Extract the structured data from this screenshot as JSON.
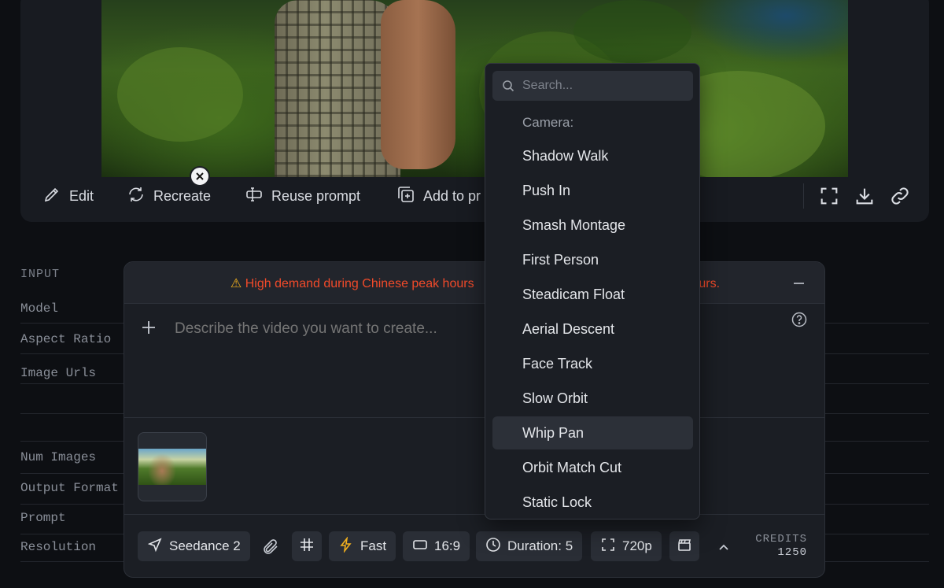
{
  "actions": {
    "edit": "Edit",
    "recreate": "Recreate",
    "reuse_prompt": "Reuse prompt",
    "add_to": "Add to pr"
  },
  "params": {
    "section_label": "INPUT",
    "rows": [
      "Model",
      "Aspect Ratio",
      "Image Urls",
      "Num Images",
      "Output Format",
      "Prompt",
      "Resolution"
    ]
  },
  "composer": {
    "banner_warn_icon": "⚠",
    "banner_left": "High demand during Chinese peak hours",
    "banner_right": "ours.",
    "prompt_placeholder": "Describe the video you want to create...",
    "toolbar": {
      "model": "Seedance 2",
      "speed": "Fast",
      "aspect": "16:9",
      "duration": "Duration: 5",
      "resolution": "720p"
    },
    "credits_label": "CREDITS",
    "credits_value": "1250"
  },
  "dropdown": {
    "search_placeholder": "Search...",
    "header": "Camera:",
    "items": [
      "Shadow Walk",
      "Push In",
      "Smash Montage",
      "First Person",
      "Steadicam Float",
      "Aerial Descent",
      "Face Track",
      "Slow Orbit",
      "Whip Pan",
      "Orbit Match Cut",
      "Static Lock"
    ],
    "active_item": "Whip Pan"
  },
  "colors": {
    "background": "#0d0f13",
    "panel": "#1b1e24",
    "warning_text": "#f04a2a",
    "warning_icon": "#f2b01e"
  }
}
